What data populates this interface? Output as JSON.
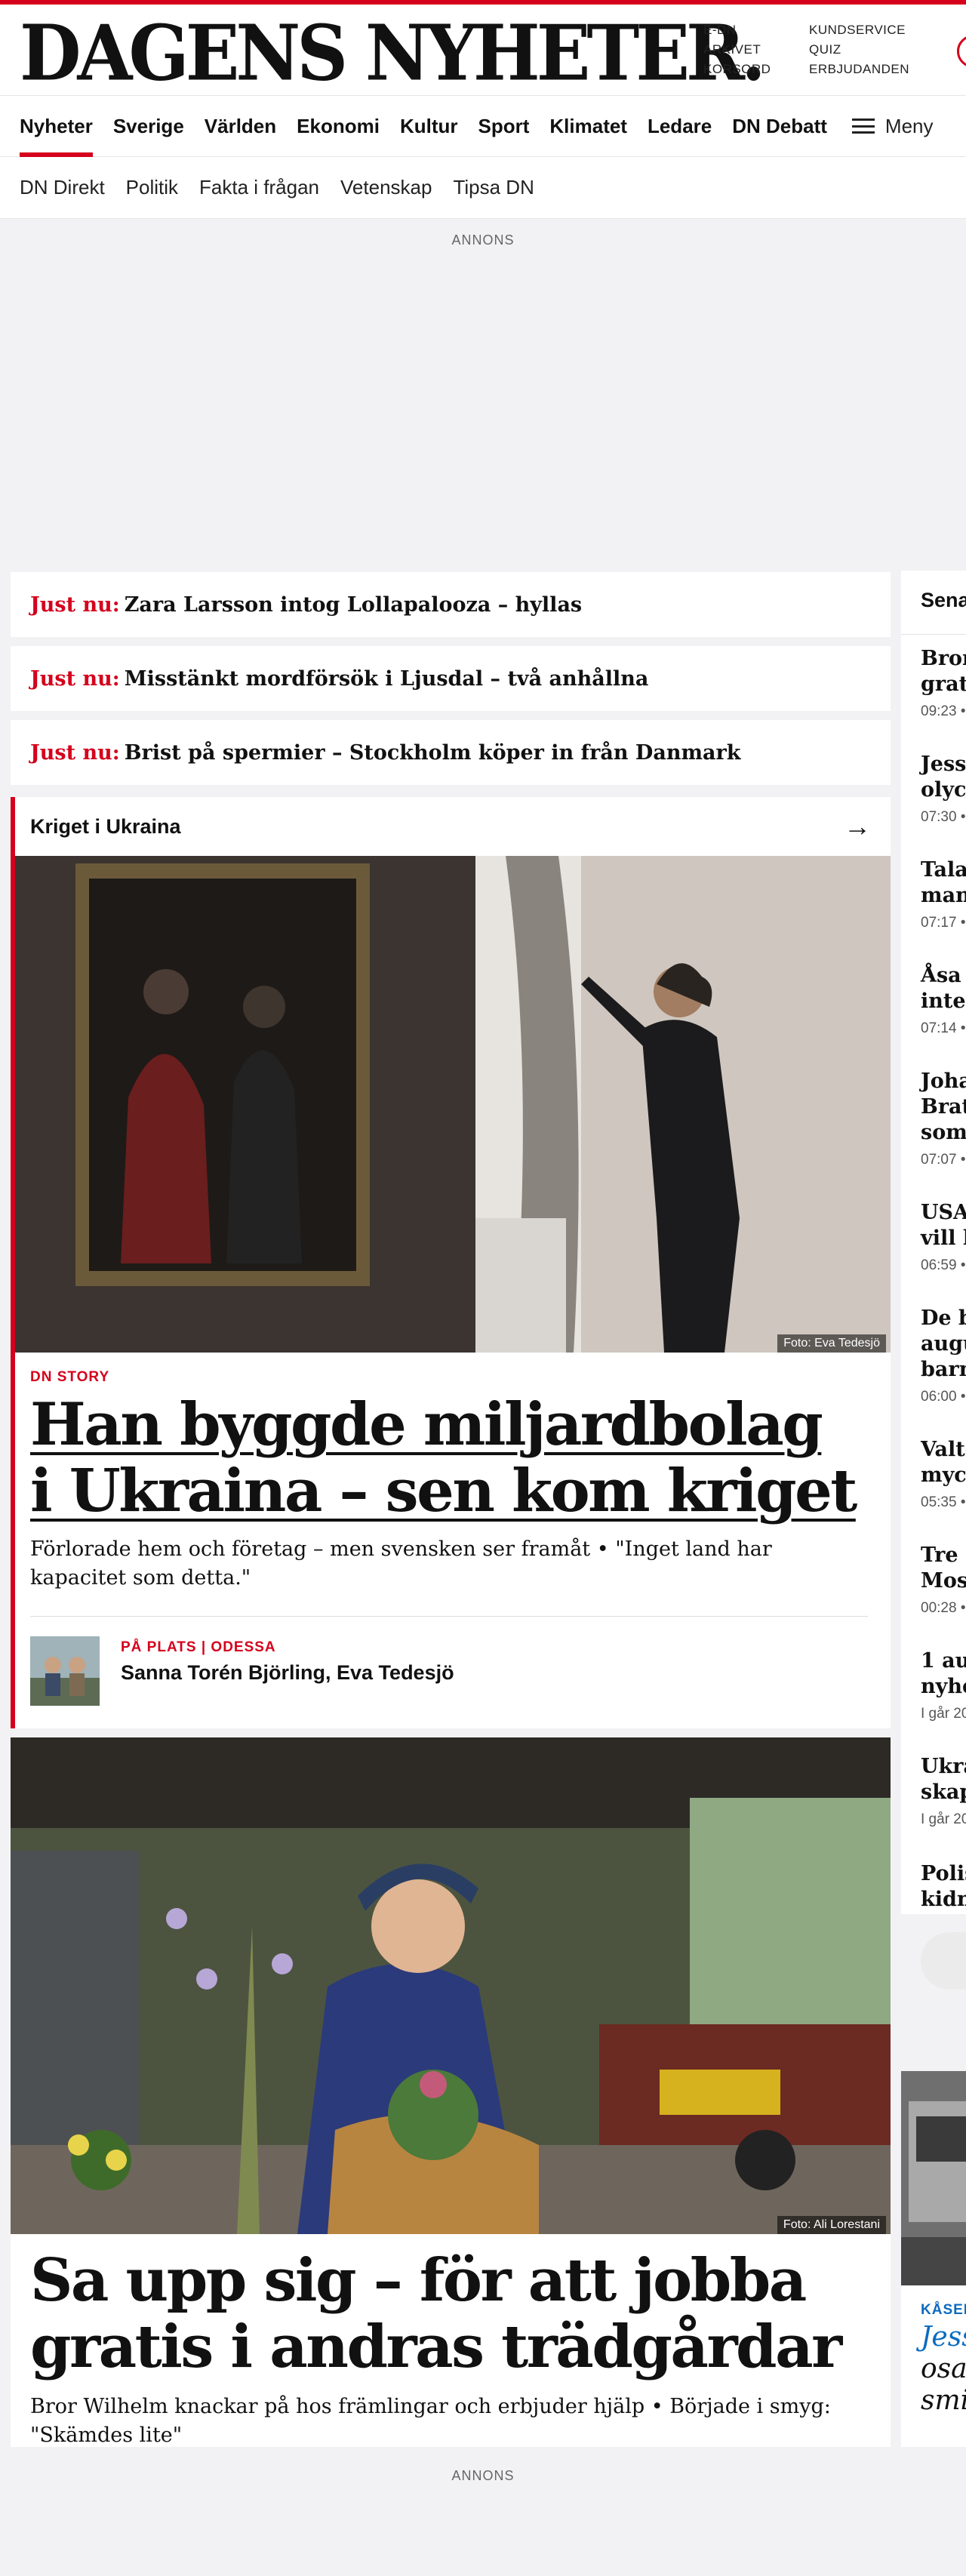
{
  "masthead": {
    "logo": "DAGENS NYHETER.",
    "util_links_1": [
      "E-DN",
      "ARKIVET",
      "KORSORD"
    ],
    "util_links_2": [
      "KUNDSERVICE",
      "QUIZ",
      "ERBJUDANDEN"
    ]
  },
  "nav": {
    "primary": [
      "Nyheter",
      "Sverige",
      "Världen",
      "Ekonomi",
      "Kultur",
      "Sport",
      "Klimatet",
      "Ledare",
      "DN Debatt"
    ],
    "menu_label": "Meny",
    "secondary": [
      "DN Direkt",
      "Politik",
      "Fakta i frågan",
      "Vetenskap",
      "Tipsa DN"
    ]
  },
  "ads": {
    "label_top": "ANNONS",
    "label_bottom": "ANNONS"
  },
  "just_nu": {
    "label": "Just nu:",
    "items": [
      "Zara Larsson intog Lollapalooza – hyllas",
      "Misstänkt mordförsök i Ljusdal – två anhållna",
      "Brist på spermier – Stockholm köper in från Danmark"
    ]
  },
  "lead_story": {
    "section": "Kriget i Ukraina",
    "photo_credit": "Foto: Eva Tedesjö",
    "kicker": "DN STORY",
    "headline": "Han byggde miljardbolag i Ukraina – sen kom kriget",
    "lead": "Förlorade hem och företag – men svensken ser framåt • \"Inget land har kapacitet som detta.\"",
    "byline_kicker": "PÅ PLATS | ODESSA",
    "byline_names": "Sanna Torén Björling, Eva Tedesjö"
  },
  "second_story": {
    "photo_credit": "Foto: Ali Lorestani",
    "headline": "Sa upp sig – för att jobba gratis i andras trädgårdar",
    "lead": "Bror Wilhelm knackar på hos främlingar och erbjuder hjälp • Började i smyg: \"Skämdes lite\""
  },
  "sidebar": {
    "title": "Sena",
    "items": [
      {
        "title": "Bron",
        "title2": "grati",
        "time": "09:23 •"
      },
      {
        "title": "Jessi",
        "title2": "olych",
        "time": "07:30 •"
      },
      {
        "title": "Tala",
        "title2": "man",
        "time": "07:17 •"
      },
      {
        "title": "Åsa I",
        "title2": "inte",
        "time": "07:14 •"
      },
      {
        "title": "Joha",
        "title2": "Brat",
        "title3": "som",
        "time": "07:07 •"
      },
      {
        "title": "USA",
        "title2": "vill h",
        "time": "06:59 •"
      },
      {
        "title": "De b",
        "title2": "augu",
        "title3": "barn",
        "time": "06:00 •"
      },
      {
        "title": "Valte",
        "title2": "mych",
        "time": "05:35 •"
      },
      {
        "title": "Tre c",
        "title2": "Mosk",
        "time": "00:28 •"
      },
      {
        "title": "1 aug",
        "title2": "nyhe",
        "time": "I går 20"
      },
      {
        "title": "Ukra",
        "title2": "skap",
        "time": "I går 20"
      },
      {
        "title": "Polis",
        "title2": "kidn",
        "time": ""
      }
    ],
    "promo_kicker": "KÅSEF",
    "promo_line1": "Jess",
    "promo_line2": "osa",
    "promo_line3": "smi"
  }
}
